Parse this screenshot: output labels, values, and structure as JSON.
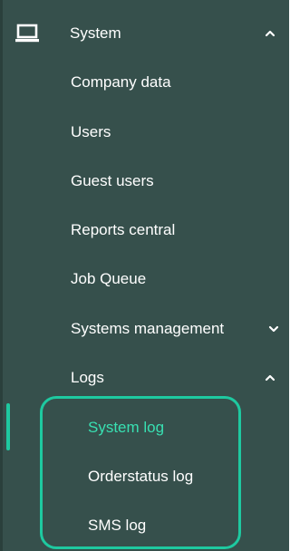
{
  "nav": {
    "system": {
      "label": "System",
      "icon": "monitor-icon",
      "expanded": true
    },
    "items": [
      {
        "label": "Company data"
      },
      {
        "label": "Users"
      },
      {
        "label": "Guest users"
      },
      {
        "label": "Reports central"
      },
      {
        "label": "Job Queue"
      }
    ],
    "systems_management": {
      "label": "Systems management",
      "expanded": false
    },
    "logs": {
      "label": "Logs",
      "expanded": true,
      "items": [
        {
          "label": "System log",
          "active": true
        },
        {
          "label": "Orderstatus log"
        },
        {
          "label": "SMS log"
        }
      ]
    }
  },
  "colors": {
    "sidebar_bg": "#36504c",
    "accent": "#1ec9a0",
    "active_text": "#38e0b2",
    "text": "#ffffff"
  }
}
